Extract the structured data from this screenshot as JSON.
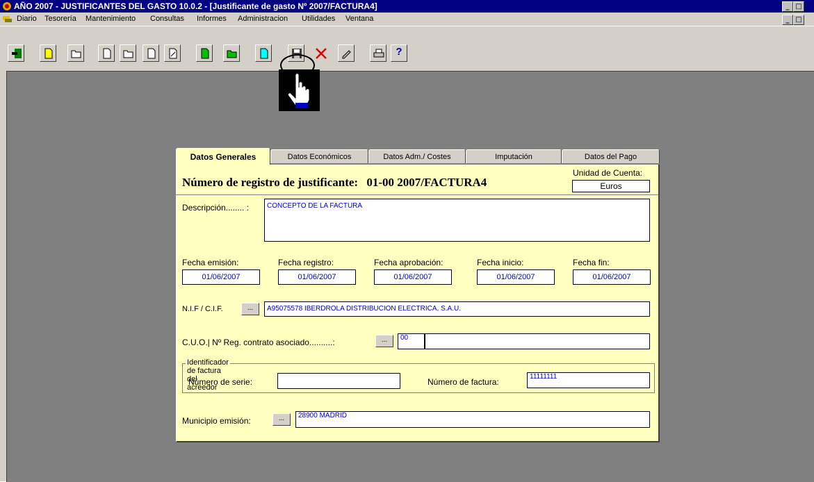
{
  "window": {
    "title": "AÑO 2007 - JUSTIFICANTES DEL GASTO 10.0.2 - [Justificante de gasto Nº 2007/FACTURA4]",
    "controls": [
      "_",
      "□",
      "×"
    ]
  },
  "menu": {
    "items": [
      "Diario",
      "Tesorería",
      "Mantenimiento",
      "Consultas",
      "Informes",
      "Administracion",
      "Utilidades",
      "Ventana"
    ]
  },
  "toolbar": {
    "buttons": [
      "exit-icon",
      "new-document-icon",
      "open-folder-icon",
      "new-document-icon",
      "open-folder-icon",
      "document-icon",
      "edit-document-icon",
      "new-green-document-icon",
      "open-green-folder-icon",
      "new-cyan-document-icon",
      "save-icon",
      "delete-icon",
      "edit-icon",
      "print-icon",
      "help-icon"
    ],
    "help_label": "?"
  },
  "tabs": [
    {
      "label": "Datos Generales",
      "active": true
    },
    {
      "label": "Datos Económicos",
      "active": false
    },
    {
      "label": "Datos Adm./ Costes",
      "active": false
    },
    {
      "label": "Imputación",
      "active": false
    },
    {
      "label": "Datos del Pago",
      "active": false
    }
  ],
  "form": {
    "registro_label": "Número de registro de justificante:",
    "registro_value": "01-00 2007/FACTURA4",
    "unidad_label": "Unidad de Cuenta:",
    "unidad_value": "Euros",
    "descripcion_label": "Descripción........ :",
    "descripcion_value": "CONCEPTO DE LA FACTURA",
    "fecha_emision_label": "Fecha emisión:",
    "fecha_emision_value": "01/06/2007",
    "fecha_registro_label": "Fecha registro:",
    "fecha_registro_value": "01/06/2007",
    "fecha_aprobacion_label": "Fecha aprobación:",
    "fecha_aprobacion_value": "01/06/2007",
    "fecha_inicio_label": "Fecha inicio:",
    "fecha_inicio_value": "01/06/2007",
    "fecha_fin_label": "Fecha fin:",
    "fecha_fin_value": "01/06/2007",
    "nif_label": "N.I.F / C.I.F.",
    "nif_value": "A95075578 IBERDROLA DISTRIBUCION ELECTRICA, S.A.U.",
    "cuo_label": "C.U.O.| Nº Reg. contrato asociado..........:",
    "cuo_code": "00",
    "cuo_value": "",
    "group_label": "Identificador de factura del acreedor",
    "serie_label": "Número de serie:",
    "serie_value": "",
    "factura_label": "Número de factura:",
    "factura_value": "11111111",
    "municipio_label": "Municipio emisión:",
    "municipio_value": "28900 MADRID",
    "lookup_button": "..."
  },
  "colors": {
    "titlebar": "#000080",
    "panel": "#ffffc0",
    "workspace": "#808080",
    "field_text": "#0000cc"
  }
}
